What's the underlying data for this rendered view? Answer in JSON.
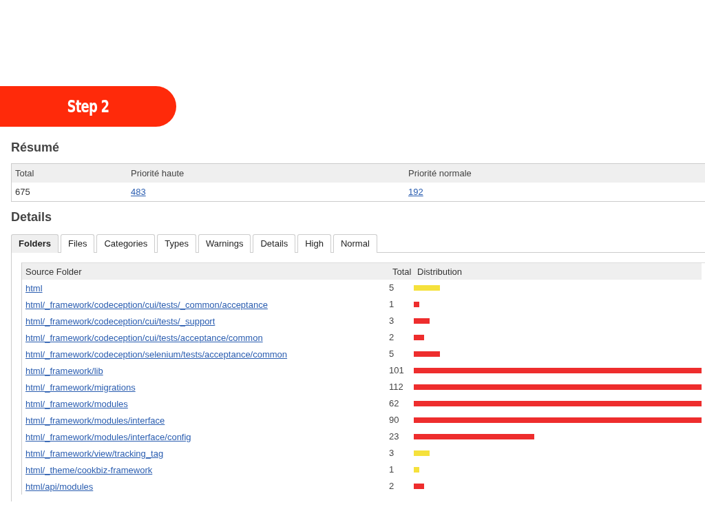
{
  "banner": {
    "title": "Step 2"
  },
  "summary": {
    "title": "Résumé",
    "columns": [
      "Total",
      "Priorité haute",
      "Priorité normale"
    ],
    "row": [
      {
        "text": "675",
        "link": false
      },
      {
        "text": "483",
        "link": true
      },
      {
        "text": "192",
        "link": true
      }
    ]
  },
  "details": {
    "title": "Details",
    "tabs": [
      {
        "label": "Folders",
        "selected": true
      },
      {
        "label": "Files",
        "selected": false
      },
      {
        "label": "Categories",
        "selected": false
      },
      {
        "label": "Types",
        "selected": false
      },
      {
        "label": "Warnings",
        "selected": false
      },
      {
        "label": "Details",
        "selected": false
      },
      {
        "label": "High",
        "selected": false
      },
      {
        "label": "Normal",
        "selected": false
      }
    ],
    "table": {
      "columns": [
        "Source Folder",
        "Total",
        "Distribution"
      ],
      "rows": [
        {
          "folder": "html",
          "total": "5",
          "color": "#f5e13c"
        },
        {
          "folder": "html/_framework/codeception/cui/tests/_common/acceptance",
          "total": "1",
          "color": "#ee2d2d"
        },
        {
          "folder": "html/_framework/codeception/cui/tests/_support",
          "total": "3",
          "color": "#ee2d2d"
        },
        {
          "folder": "html/_framework/codeception/cui/tests/acceptance/common",
          "total": "2",
          "color": "#ee2d2d"
        },
        {
          "folder": "html/_framework/codeception/selenium/tests/acceptance/common",
          "total": "5",
          "color": "#ee2d2d"
        },
        {
          "folder": "html/_framework/lib",
          "total": "101",
          "color": "#ee2d2d"
        },
        {
          "folder": "html/_framework/migrations",
          "total": "112",
          "color": "#ee2d2d"
        },
        {
          "folder": "html/_framework/modules",
          "total": "62",
          "color": "#ee2d2d"
        },
        {
          "folder": "html/_framework/modules/interface",
          "total": "90",
          "color": "#ee2d2d"
        },
        {
          "folder": "html/_framework/modules/interface/config",
          "total": "23",
          "color": "#ee2d2d"
        },
        {
          "folder": "html/_framework/view/tracking_tag",
          "total": "3",
          "color": "#f5e13c"
        },
        {
          "folder": "html/_theme/cookbiz-framework",
          "total": "1",
          "color": "#f5e13c"
        },
        {
          "folder": "html/api/modules",
          "total": "2",
          "color": "#ee2d2d"
        }
      ]
    }
  }
}
